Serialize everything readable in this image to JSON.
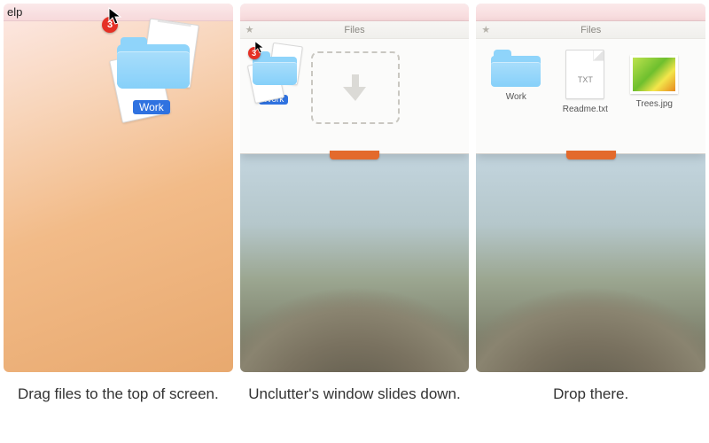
{
  "panel1": {
    "menu_fragment": "elp",
    "badge_count": "3",
    "dragged_label": "Work"
  },
  "panel2": {
    "window_title": "Files",
    "badge_count": "3",
    "dragged_label": "Work"
  },
  "panel3": {
    "window_title": "Files",
    "items": {
      "folder_label": "Work",
      "txt_label": "Readme.txt",
      "txt_ext": "TXT",
      "img_label": "Trees.jpg"
    }
  },
  "captions": {
    "c1": "Drag files to the top of screen.",
    "c2": "Unclutter's window slides down.",
    "c3": "Drop there."
  }
}
